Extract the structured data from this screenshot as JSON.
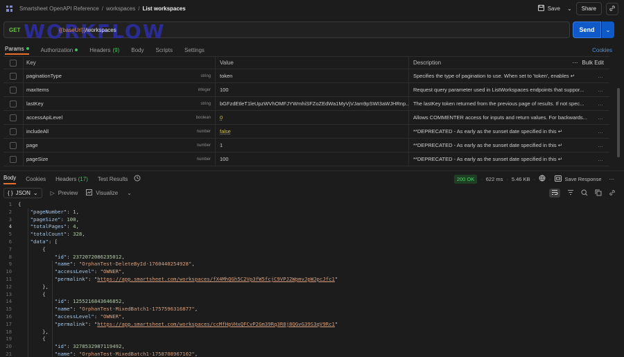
{
  "breadcrumb": {
    "collection": "Smartsheet OpenAPI Reference",
    "folder": "workspaces",
    "request": "List workspaces",
    "separator": "/"
  },
  "toolbar": {
    "save_label": "Save",
    "share_label": "Share"
  },
  "request": {
    "method": "GET",
    "url_var": "{{baseUrl}}",
    "url_path": "/workspaces",
    "watermark": "WORKFLOW",
    "send_label": "Send"
  },
  "request_tabs": {
    "params": "Params",
    "authorization": "Authorization",
    "headers": "Headers",
    "headers_count": "(9)",
    "body": "Body",
    "scripts": "Scripts",
    "settings": "Settings",
    "cookies": "Cookies"
  },
  "params_table": {
    "headers": {
      "key": "Key",
      "value": "Value",
      "description": "Description",
      "bulk_edit": "Bulk Edit"
    },
    "rows": [
      {
        "key": "paginationType",
        "type": "string",
        "value": "token",
        "description": "Specifies the type of pagination to use. When set to 'token', enables ↵"
      },
      {
        "key": "maxItems",
        "type": "integer",
        "value": "100",
        "description": "Request query parameter used in ListWorkspaces endpoints that suppor..."
      },
      {
        "key": "lastKey",
        "type": "string",
        "value": "bGFzdEtleT1leUpzWVhOMFJYWmhiSFZoZEdWa1MyVjVJam9pSWI3aWJHRnp...",
        "description": "The lastKey token returned from the previous page of results. If not spec..."
      },
      {
        "key": "accessApiLevel",
        "type": "boolean",
        "value": "0",
        "description": "Allows COMMENTER access for inputs and return values. For backwards..."
      },
      {
        "key": "includeAll",
        "type": "number",
        "value": "false",
        "description": "**DEPRECATED - As early as the sunset date specified in this ↵"
      },
      {
        "key": "page",
        "type": "number",
        "value": "1",
        "description": "**DEPRECATED - As early as the sunset date specified in this ↵"
      },
      {
        "key": "pageSize",
        "type": "number",
        "value": "100",
        "description": "**DEPRECATED - As early as the sunset date specified in this ↵"
      }
    ]
  },
  "response_tabs": {
    "body": "Body",
    "cookies": "Cookies",
    "headers": "Headers",
    "headers_count": "(17)",
    "test_results": "Test Results"
  },
  "response_meta": {
    "status": "200 OK",
    "time": "622 ms",
    "size": "5.46 KB",
    "save_response": "Save Response"
  },
  "response_toolbar": {
    "format": "JSON",
    "preview": "Preview",
    "visualize": "Visualize"
  },
  "code_lines": [
    "{",
    "    \"pageNumber\": 1,",
    "    \"pageSize\": 100,",
    "    \"totalPages\": 4,",
    "    \"totalCount\": 328,",
    "    \"data\": [",
    "        {",
    "            \"id\": 2372072086235012,",
    "            \"name\": \"OrphanTest-DeleteById-1760440254928\",",
    "            \"accessLevel\": \"OWNER\",",
    "            \"permalink\": \"https://app.smartsheet.com/workspaces/fX4MhQGh5C2Vp3fW5fcjC9VPJ2WpmvJpWJpcJfc1\"",
    "        },",
    "        {",
    "            \"id\": 1255216843646852,",
    "            \"name\": \"OrphanTest-MixedBatch1-1757596316877\",",
    "            \"accessLevel\": \"OWNER\",",
    "            \"permalink\": \"https://app.smartsheet.com/workspaces/ccMfHpVHxQFCvP2Gm39Rq3R8j8QGvG39S3qV9Rc1\"",
    "        },",
    "        {",
    "            \"id\": 3278532987119492,",
    "            \"name\": \"OrphanTest-MixedBatch1-1758708967102\","
  ],
  "code_line_numbers": [
    "1",
    "2",
    "3",
    "4",
    "5",
    "6",
    "7",
    "8",
    "9",
    "10",
    "11",
    "12",
    "13",
    "14",
    "15",
    "16",
    "17",
    "18",
    "19",
    "20",
    "21"
  ],
  "colors": {
    "accent": "#e8702a",
    "send": "#0f5ac9",
    "method_get": "#6cc04a",
    "status_ok": "#4fd06a",
    "link": "#4a92e6"
  },
  "icons": [
    "api-icon",
    "save-icon",
    "chevron-down-icon",
    "link-icon",
    "ellipsis-icon",
    "history-icon",
    "globe-icon",
    "save-response-icon",
    "play-icon",
    "visualize-icon",
    "wrap-icon",
    "filter-icon",
    "search-icon",
    "copy-icon"
  ]
}
